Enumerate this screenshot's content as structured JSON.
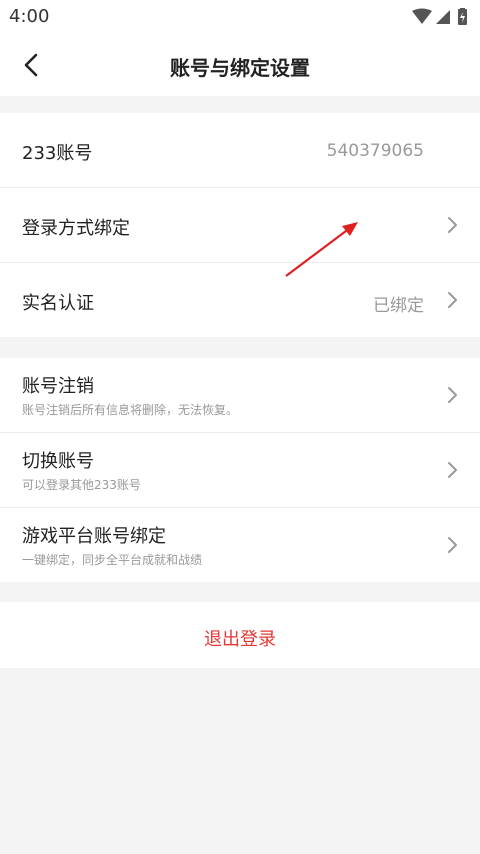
{
  "status_bar": {
    "time": "4:00",
    "icons": [
      "wifi-icon",
      "signal-icon",
      "battery-icon"
    ]
  },
  "header": {
    "back_icon": "chevron-left-icon",
    "title": "账号与绑定设置"
  },
  "account_group": [
    {
      "label": "233账号",
      "value": "540379065",
      "chevron": false
    },
    {
      "label": "登录方式绑定",
      "value": "",
      "chevron": true
    },
    {
      "label": "实名认证",
      "value": "已绑定",
      "chevron": true
    }
  ],
  "manage_group": [
    {
      "label": "账号注销",
      "sub": "账号注销后所有信息将删除，无法恢复。",
      "chevron": true
    },
    {
      "label": "切换账号",
      "sub": "可以登录其他233账号",
      "chevron": true
    },
    {
      "label": "游戏平台账号绑定",
      "sub": "一键绑定，同步全平台成就和战绩",
      "chevron": true
    }
  ],
  "logout_label": "退出登录",
  "colors": {
    "background": "#f4f4f4",
    "logout_red": "#e53935",
    "annotation_arrow": "#e02020",
    "secondary_text": "#999999"
  }
}
